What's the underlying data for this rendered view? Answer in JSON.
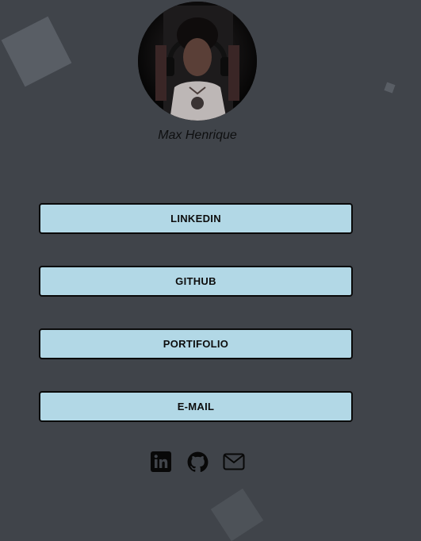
{
  "profile": {
    "name": "Max Henrique",
    "avatar_alt": "profile photo"
  },
  "links": [
    {
      "label": "LINKEDIN"
    },
    {
      "label": "GITHUB"
    },
    {
      "label": "PORTIFOLIO"
    },
    {
      "label": "E-MAIL"
    }
  ],
  "social": [
    {
      "icon": "linkedin-icon"
    },
    {
      "icon": "github-icon"
    },
    {
      "icon": "mail-icon"
    }
  ],
  "colors": {
    "background": "#40444a",
    "button": "#b2d8e6",
    "button_border": "#0a0a0a",
    "decor_square": "#595e65"
  }
}
